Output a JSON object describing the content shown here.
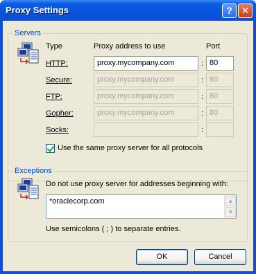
{
  "window": {
    "title": "Proxy Settings",
    "help_button": "?",
    "close_button": "✕"
  },
  "servers": {
    "group_title": "Servers",
    "col_type": "Type",
    "col_address": "Proxy address to use",
    "col_port": "Port",
    "rows": [
      {
        "type": "HTTP:",
        "address": "proxy.mycompany.com",
        "port": "80",
        "enabled": true
      },
      {
        "type": "Secure:",
        "address": "proxy.mycompany.com",
        "port": "80",
        "enabled": false
      },
      {
        "type": "FTP:",
        "address": "proxy.mycompany.com",
        "port": "80",
        "enabled": false
      },
      {
        "type": "Gopher:",
        "address": "proxy.mycompany.com",
        "port": "80",
        "enabled": false
      },
      {
        "type": "Socks:",
        "address": "",
        "port": "",
        "enabled": false
      }
    ],
    "colon": ":",
    "same_proxy_label": "Use the same proxy server for all protocols",
    "same_proxy_checked": true
  },
  "exceptions": {
    "group_title": "Exceptions",
    "description": "Do not use proxy server for addresses beginning with:",
    "value": "*oraclecorp.com",
    "hint": "Use semicolons ( ; ) to separate entries."
  },
  "buttons": {
    "ok": "OK",
    "cancel": "Cancel"
  },
  "icons": {
    "servers": "network-computers-icon",
    "exceptions": "network-computers-icon",
    "scroll_up": "▲",
    "scroll_down": "▼"
  }
}
